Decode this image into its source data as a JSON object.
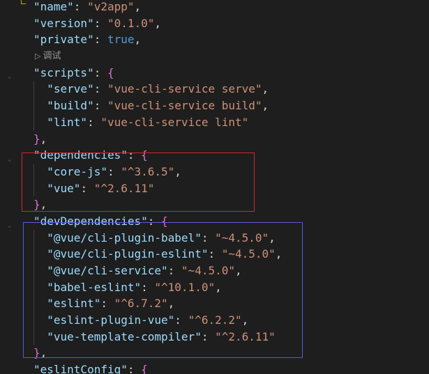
{
  "colors": {
    "background": "#1e1e1e",
    "key": "#9cdcfe",
    "string": "#ce9178",
    "boolean": "#569cd6",
    "brace_level1": "#ffd700",
    "brace_level2": "#da70d6",
    "highlight_red": "#d9262b",
    "highlight_blue": "#5a5ad6"
  },
  "icons": {
    "fold": "chevron-down-icon",
    "codelens": "play-triangle-icon"
  },
  "codelens": {
    "label": "调试"
  },
  "json": {
    "name": {
      "key": "\"name\"",
      "value": "\"v2app\""
    },
    "version": {
      "key": "\"version\"",
      "value": "\"0.1.0\""
    },
    "private": {
      "key": "\"private\"",
      "value": "true"
    },
    "scripts": {
      "key": "\"scripts\"",
      "entries": [
        {
          "key": "\"serve\"",
          "value": "\"vue-cli-service serve\""
        },
        {
          "key": "\"build\"",
          "value": "\"vue-cli-service build\""
        },
        {
          "key": "\"lint\"",
          "value": "\"vue-cli-service lint\""
        }
      ]
    },
    "dependencies": {
      "key": "\"dependencies\"",
      "entries": [
        {
          "key": "\"core-js\"",
          "value": "\"^3.6.5\""
        },
        {
          "key": "\"vue\"",
          "value": "\"^2.6.11\""
        }
      ]
    },
    "devDependencies": {
      "key": "\"devDependencies\"",
      "entries": [
        {
          "key": "\"@vue/cli-plugin-babel\"",
          "value": "\"~4.5.0\""
        },
        {
          "key": "\"@vue/cli-plugin-eslint\"",
          "value": "\"~4.5.0\""
        },
        {
          "key": "\"@vue/cli-service\"",
          "value": "\"~4.5.0\""
        },
        {
          "key": "\"babel-eslint\"",
          "value": "\"^10.1.0\""
        },
        {
          "key": "\"eslint\"",
          "value": "\"^6.7.2\""
        },
        {
          "key": "\"eslint-plugin-vue\"",
          "value": "\"^6.2.2\""
        },
        {
          "key": "\"vue-template-compiler\"",
          "value": "\"^2.6.11\""
        }
      ]
    },
    "eslintConfig": {
      "key": "\"eslintConfig\""
    }
  }
}
